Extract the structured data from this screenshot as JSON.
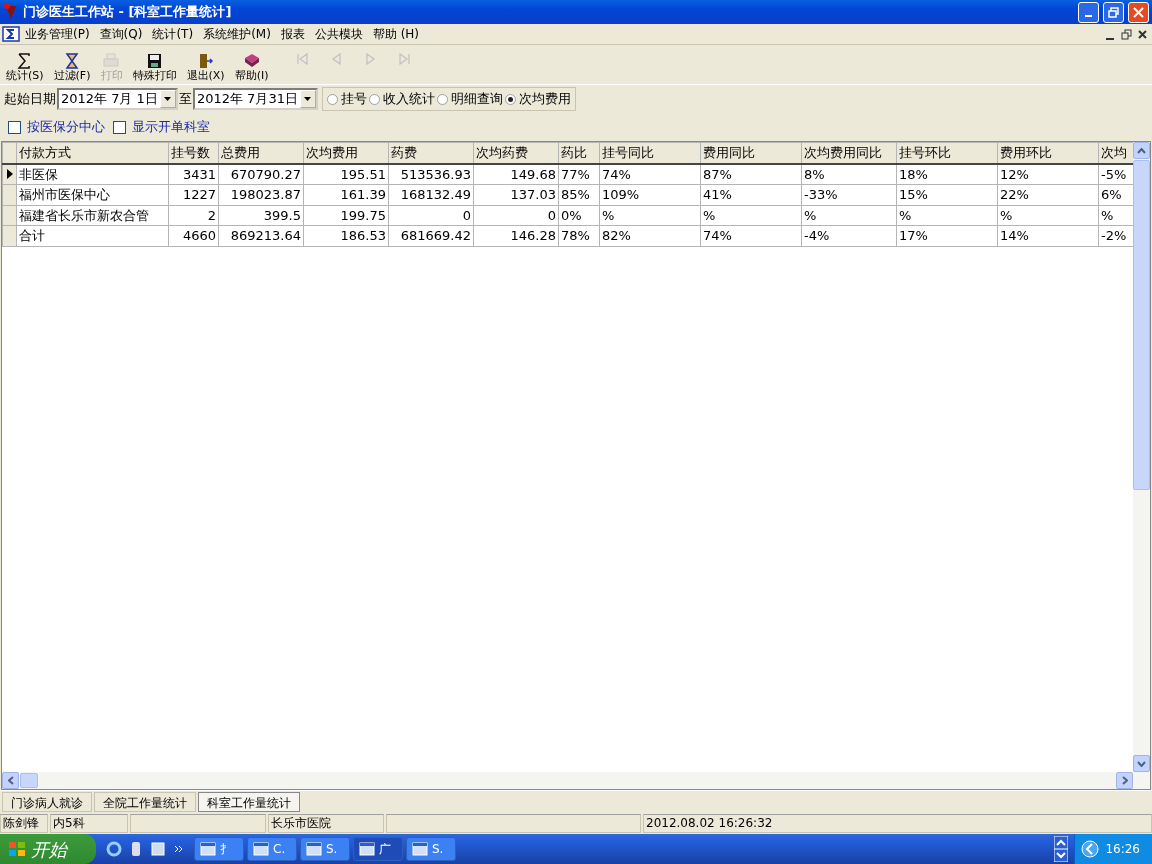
{
  "window": {
    "title": "门诊医生工作站 - [科室工作量统计]"
  },
  "menu": [
    "业务管理(P)",
    "查询(Q)",
    "统计(T)",
    "系统维护(M)",
    "报表",
    "公共模块",
    "帮助 (H)"
  ],
  "toolbar": [
    {
      "label": "统计(S)",
      "kind": "sigma",
      "disabled": false
    },
    {
      "label": "过滤(F)",
      "kind": "hourglass",
      "disabled": false
    },
    {
      "label": "打印",
      "kind": "printer",
      "disabled": true
    },
    {
      "label": "特殊打印",
      "kind": "disk",
      "disabled": false
    },
    {
      "label": "退出(X)",
      "kind": "door",
      "disabled": false
    },
    {
      "label": "帮助(I)",
      "kind": "book",
      "disabled": false
    }
  ],
  "nav_buttons": [
    {
      "kind": "first",
      "disabled": true
    },
    {
      "kind": "prev",
      "disabled": true
    },
    {
      "kind": "next",
      "disabled": true
    },
    {
      "kind": "last",
      "disabled": true
    }
  ],
  "date_filter": {
    "label": "起始日期",
    "start_date": "2012年 7月 1日",
    "to_label": "至",
    "end_date": "2012年 7月31日"
  },
  "modes": [
    {
      "label": "挂号",
      "selected": false
    },
    {
      "label": "收入统计",
      "selected": false
    },
    {
      "label": "明细查询",
      "selected": false
    },
    {
      "label": "次均费用",
      "selected": true
    }
  ],
  "options": [
    {
      "label": "按医保分中心",
      "checked": false
    },
    {
      "label": "显示开单科室",
      "checked": false
    }
  ],
  "table": {
    "columns": [
      {
        "label": "付款方式",
        "kind": "text"
      },
      {
        "label": "挂号数",
        "kind": "number"
      },
      {
        "label": "总费用",
        "kind": "number"
      },
      {
        "label": "次均费用",
        "kind": "number"
      },
      {
        "label": "药费",
        "kind": "number"
      },
      {
        "label": "次均药费",
        "kind": "number"
      },
      {
        "label": "药比",
        "kind": "text"
      },
      {
        "label": "挂号同比",
        "kind": "text"
      },
      {
        "label": "费用同比",
        "kind": "text"
      },
      {
        "label": "次均费用同比",
        "kind": "text"
      },
      {
        "label": "挂号环比",
        "kind": "text"
      },
      {
        "label": "费用环比",
        "kind": "text"
      },
      {
        "label": "次均",
        "kind": "text"
      }
    ],
    "rows": [
      {
        "selected": true,
        "cells": [
          "非医保",
          "3431",
          "670790.27",
          "195.51",
          "513536.93",
          "149.68",
          "77%",
          "74%",
          "87%",
          "8%",
          "18%",
          "12%",
          "-5%"
        ]
      },
      {
        "selected": false,
        "cells": [
          "福州市医保中心",
          "1227",
          "198023.87",
          "161.39",
          "168132.49",
          "137.03",
          "85%",
          "109%",
          "41%",
          "-33%",
          "15%",
          "22%",
          "6%"
        ]
      },
      {
        "selected": false,
        "cells": [
          "福建省长乐市新农合管",
          "2",
          "399.5",
          "199.75",
          "0",
          "0",
          "0%",
          "%",
          "%",
          "%",
          "%",
          "%",
          "%"
        ]
      },
      {
        "selected": false,
        "cells": [
          "合计",
          "4660",
          "869213.64",
          "186.53",
          "681669.42",
          "146.28",
          "78%",
          "82%",
          "74%",
          "-4%",
          "17%",
          "14%",
          "-2%"
        ]
      }
    ]
  },
  "bottom_tabs": [
    {
      "label": "门诊病人就诊",
      "selected": false
    },
    {
      "label": "全院工作量统计",
      "selected": false
    },
    {
      "label": "科室工作量统计",
      "selected": true
    }
  ],
  "status_bar": {
    "user": "陈剑锋",
    "department": "内5科",
    "hospital": "长乐市医院",
    "datetime": "2012.08.02 16:26:32"
  },
  "taskbar": {
    "start": "开始",
    "tasks": [
      {
        "label": "扌",
        "selected": false
      },
      {
        "label": "C.",
        "selected": false
      },
      {
        "label": "S.",
        "selected": false
      },
      {
        "label": "广",
        "selected": true
      },
      {
        "label": "S.",
        "selected": false
      }
    ],
    "clock": "16:26"
  }
}
